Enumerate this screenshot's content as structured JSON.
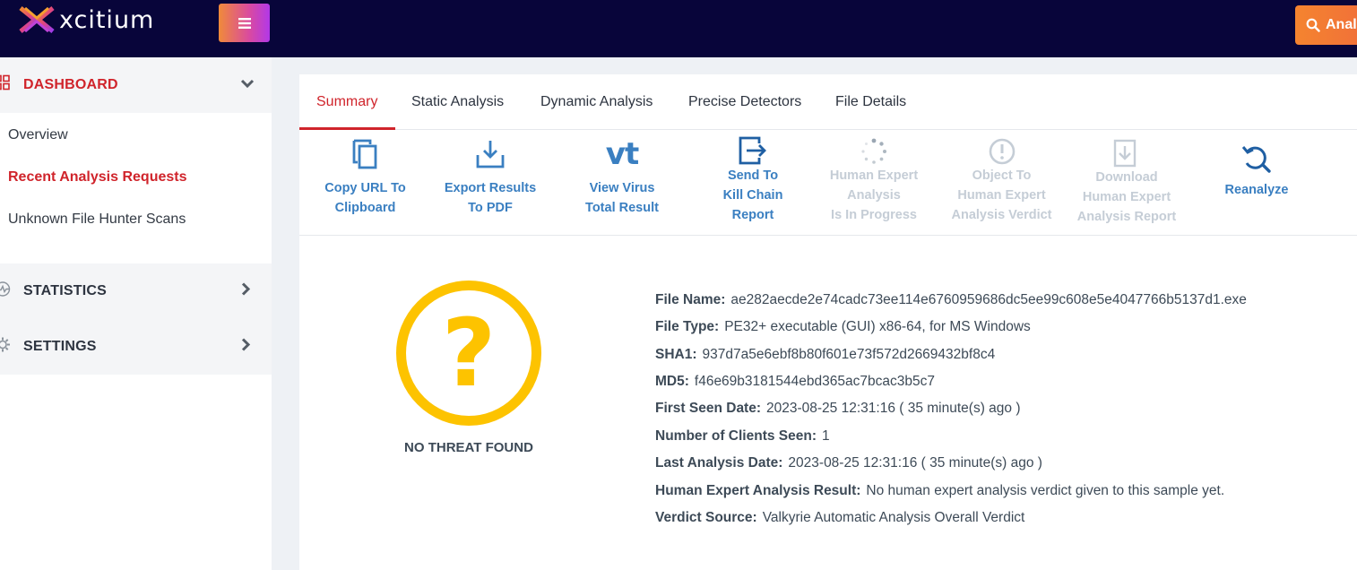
{
  "app": {
    "logo_text": "xcitium",
    "analyze_label": "Anal"
  },
  "colors": {
    "accent_red": "#d0242b",
    "link_blue": "#3a7fc1",
    "topbar": "#08053a",
    "verdict_yellow": "#fdc300"
  },
  "sidebar": {
    "dashboard": {
      "label": "DASHBOARD",
      "icon": "grid-icon"
    },
    "items": [
      {
        "label": "Overview",
        "active": false
      },
      {
        "label": "Recent Analysis Requests",
        "active": true
      },
      {
        "label": "Unknown File Hunter Scans",
        "active": false
      }
    ],
    "statistics": {
      "label": "STATISTICS",
      "icon": "pulse-icon"
    },
    "settings": {
      "label": "SETTINGS",
      "icon": "gear-icon"
    }
  },
  "tabs": [
    {
      "label": "Summary",
      "active": true
    },
    {
      "label": "Static Analysis",
      "active": false
    },
    {
      "label": "Dynamic Analysis",
      "active": false
    },
    {
      "label": "Precise Detectors",
      "active": false
    },
    {
      "label": "File Details",
      "active": false
    }
  ],
  "toolbar": {
    "copy_url": "Copy URL To\nClipboard",
    "export_pdf": "Export Results\nTo PDF",
    "virus_total": "View Virus\nTotal Result",
    "kill_chain": "Send To\nKill Chain\nReport",
    "human_expert": "Human Expert\nAnalysis\nIs In Progress",
    "object_to": "Object To\nHuman Expert\nAnalysis Verdict",
    "download_report": "Download\nHuman Expert\nAnalysis Report",
    "reanalyze": "Reanalyze",
    "vt_glyph": "vt"
  },
  "verdict": {
    "label": "NO THREAT FOUND",
    "glyph": "?"
  },
  "file_info": [
    {
      "key": "File Name:",
      "value": "ae282aecde2e74cadc73ee114e6760959686dc5ee99c608e5e4047766b5137d1.exe"
    },
    {
      "key": "File Type:",
      "value": "PE32+ executable (GUI) x86-64, for MS Windows"
    },
    {
      "key": "SHA1:",
      "value": "937d7a5e6ebf8b80f601e73f572d2669432bf8c4"
    },
    {
      "key": "MD5:",
      "value": "f46e69b3181544ebd365ac7bcac3b5c7"
    },
    {
      "key": "First Seen Date:",
      "value": "2023-08-25 12:31:16 ( 35 minute(s) ago )"
    },
    {
      "key": "Number of Clients Seen:",
      "value": "1"
    },
    {
      "key": "Last Analysis Date:",
      "value": "2023-08-25 12:31:16 ( 35 minute(s) ago )"
    },
    {
      "key": "Human Expert Analysis Result:",
      "value": "No human expert analysis verdict given to this sample yet."
    },
    {
      "key": "Verdict Source:",
      "value": "Valkyrie Automatic Analysis Overall Verdict"
    }
  ]
}
